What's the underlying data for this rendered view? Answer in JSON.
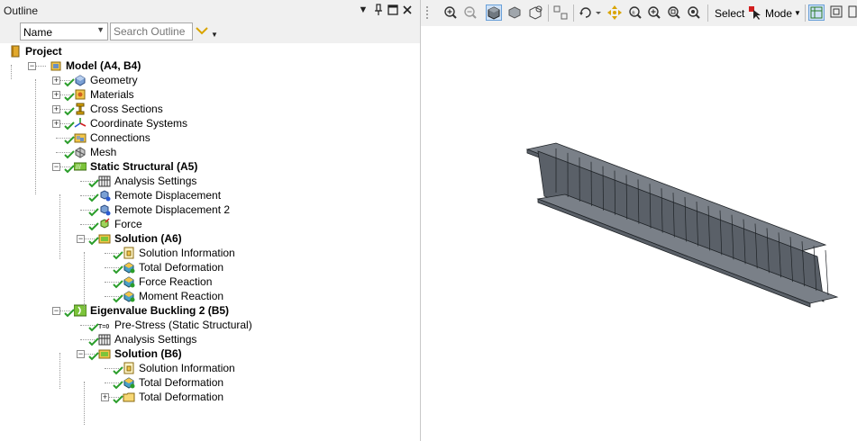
{
  "outline_panel": {
    "title": "Outline",
    "header_buttons": [
      "dropdown-arrow",
      "pin",
      "maximize",
      "close"
    ],
    "filter": {
      "selected": "Name",
      "search_placeholder": "Search Outline"
    },
    "tree": [
      {
        "label": "Project",
        "bold": true,
        "icon": "project-icon",
        "check": false,
        "expander": "none"
      },
      {
        "label": "Model (A4, B4)",
        "bold": true,
        "icon": "model-icon",
        "check": false,
        "expander": "minus"
      },
      {
        "label": "Geometry",
        "bold": false,
        "icon": "geometry-icon",
        "check": true,
        "expander": "plus"
      },
      {
        "label": "Materials",
        "bold": false,
        "icon": "materials-icon",
        "check": true,
        "expander": "plus"
      },
      {
        "label": "Cross Sections",
        "bold": false,
        "icon": "cross-sections-icon",
        "check": true,
        "expander": "plus"
      },
      {
        "label": "Coordinate Systems",
        "bold": false,
        "icon": "coordinate-systems-icon",
        "check": true,
        "expander": "plus"
      },
      {
        "label": "Connections",
        "bold": false,
        "icon": "connections-icon",
        "check": true,
        "expander": "none"
      },
      {
        "label": "Mesh",
        "bold": false,
        "icon": "mesh-icon",
        "check": true,
        "expander": "none"
      },
      {
        "label": "Static Structural (A5)",
        "bold": true,
        "icon": "static-structural-icon",
        "check": true,
        "expander": "minus"
      },
      {
        "label": "Analysis Settings",
        "bold": false,
        "icon": "analysis-settings-icon",
        "check": true,
        "expander": "none"
      },
      {
        "label": "Remote Displacement",
        "bold": false,
        "icon": "remote-displacement-icon",
        "check": true,
        "expander": "none"
      },
      {
        "label": "Remote Displacement 2",
        "bold": false,
        "icon": "remote-displacement-icon",
        "check": true,
        "expander": "none"
      },
      {
        "label": "Force",
        "bold": false,
        "icon": "force-icon",
        "check": true,
        "expander": "none"
      },
      {
        "label": "Solution (A6)",
        "bold": true,
        "icon": "solution-icon",
        "check": true,
        "expander": "minus"
      },
      {
        "label": "Solution Information",
        "bold": false,
        "icon": "solution-information-icon",
        "check": true,
        "expander": "none"
      },
      {
        "label": "Total Deformation",
        "bold": false,
        "icon": "result-icon",
        "check": true,
        "expander": "none"
      },
      {
        "label": "Force Reaction",
        "bold": false,
        "icon": "result-icon",
        "check": true,
        "expander": "none"
      },
      {
        "label": "Moment Reaction",
        "bold": false,
        "icon": "result-icon",
        "check": true,
        "expander": "none"
      },
      {
        "label": "Eigenvalue Buckling 2 (B5)",
        "bold": true,
        "icon": "eigenvalue-buckling-icon",
        "check": true,
        "expander": "minus"
      },
      {
        "label": "Pre-Stress (Static Structural)",
        "bold": false,
        "icon": "pre-stress-icon",
        "check": true,
        "expander": "none"
      },
      {
        "label": "Analysis Settings",
        "bold": false,
        "icon": "analysis-settings-icon",
        "check": true,
        "expander": "none"
      },
      {
        "label": "Solution (B6)",
        "bold": true,
        "icon": "solution-icon",
        "check": true,
        "expander": "minus"
      },
      {
        "label": "Solution Information",
        "bold": false,
        "icon": "solution-information-icon",
        "check": true,
        "expander": "none"
      },
      {
        "label": "Total Deformation",
        "bold": false,
        "icon": "result-icon",
        "check": true,
        "expander": "none"
      },
      {
        "label": "Total Deformation",
        "bold": false,
        "icon": "folder-icon",
        "check": true,
        "expander": "plus"
      }
    ],
    "pre_stress_icon_text": "T=0"
  },
  "viewport": {
    "toolbar": {
      "select_label": "Select",
      "mode_label": "Mode",
      "buttons": [
        "zoom-in-icon",
        "zoom-out-icon",
        "solid-view-icon",
        "shaded-view-icon",
        "wireframe-view-icon",
        "fit-icon",
        "rotate-icon",
        "pan-icon",
        "zoom-icon",
        "box-zoom-icon",
        "zoom-fit-icon",
        "zoom-to-fit-icon",
        "select-cursor-icon",
        "face-select-icon",
        "body-select-icon"
      ]
    },
    "model": "I-beam",
    "colors": {
      "beam_face": "#5a6068",
      "beam_top": "#7a8088",
      "beam_edge": "#1e2226",
      "check_green": "#2a9d2a",
      "selection_blue": "#cfe2f7"
    }
  }
}
